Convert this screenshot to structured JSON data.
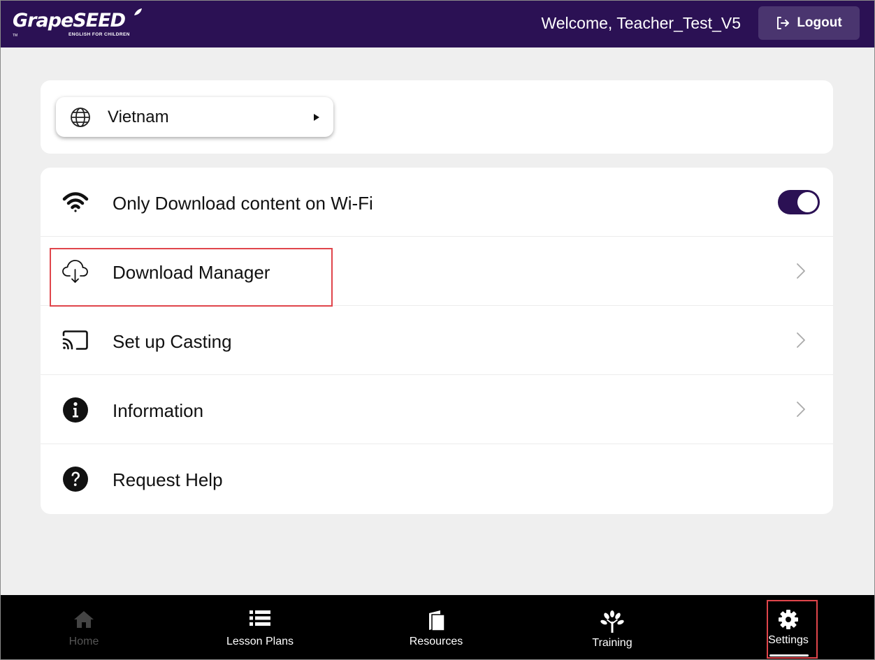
{
  "header": {
    "logo_text": "GrapeSEED",
    "logo_tagline": "ENGLISH FOR CHILDREN",
    "logo_tm": "TM",
    "welcome": "Welcome, Teacher_Test_V5",
    "logout_label": "Logout"
  },
  "region": {
    "label": "Vietnam",
    "icon": "globe-icon"
  },
  "settings": {
    "items": [
      {
        "label": "Only Download content on Wi-Fi",
        "icon": "wifi-icon",
        "toggle_on": true
      },
      {
        "label": "Download Manager",
        "icon": "cloud-download-icon"
      },
      {
        "label": "Set up Casting",
        "icon": "cast-icon"
      },
      {
        "label": "Information",
        "icon": "info-icon"
      },
      {
        "label": "Request Help",
        "icon": "help-icon"
      }
    ]
  },
  "nav": {
    "items": [
      {
        "label": "Home",
        "icon": "home-icon",
        "disabled": true
      },
      {
        "label": "Lesson Plans",
        "icon": "list-icon"
      },
      {
        "label": "Resources",
        "icon": "book-icon"
      },
      {
        "label": "Training",
        "icon": "tree-icon"
      },
      {
        "label": "Settings",
        "icon": "gear-icon",
        "active": true
      }
    ]
  },
  "colors": {
    "header_bg": "#2b1154",
    "logout_bg": "#4a356f",
    "toggle_on": "#2b1154",
    "highlight": "#e0454b",
    "nav_bg": "#000000"
  }
}
